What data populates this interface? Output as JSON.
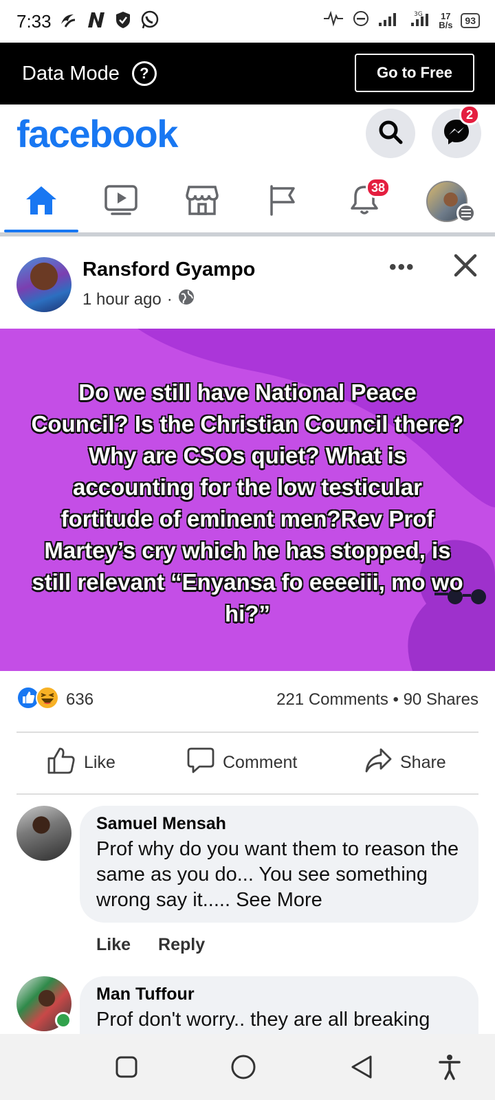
{
  "status_bar": {
    "time": "7:33",
    "net_speed_value": "17",
    "net_speed_unit": "B/s",
    "battery": "93"
  },
  "data_mode": {
    "label": "Data Mode",
    "go_free_label": "Go to Free"
  },
  "header": {
    "logo": "facebook",
    "messenger_badge": "2"
  },
  "nav": {
    "notifications_badge": "38"
  },
  "post": {
    "author": "Ransford Gyampo",
    "time": "1 hour ago",
    "separator": "·",
    "text": "Do we still have National Peace Council? Is the Christian Council there? Why are CSOs quiet? What is accounting for the low testicular fortitude of eminent men?Rev Prof Martey’s cry which he has stopped, is still relevant “Enyansa fo eeeeiii, mo wo hi?”",
    "background_color": "#c44ee6",
    "reaction_count": "636",
    "comments_shares": "221 Comments • 90 Shares"
  },
  "actions": {
    "like": "Like",
    "comment": "Comment",
    "share": "Share"
  },
  "comments": [
    {
      "name": "Samuel Mensah",
      "text": "Prof why do you want them to reason the same as you do... You see something wrong say it..... See More",
      "like": "Like",
      "reply": "Reply"
    },
    {
      "name": "Man Tuffour",
      "text": "Prof don't worry.. they are all breaking"
    }
  ],
  "colors": {
    "brand": "#1877f2",
    "badge": "#e41e3f"
  }
}
